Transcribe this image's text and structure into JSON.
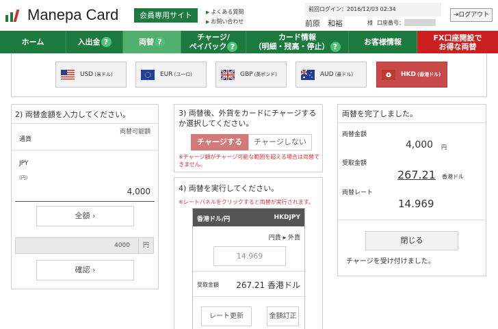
{
  "header": {
    "logo_text": "Manepa Card",
    "member_badge": "会員専用サイト",
    "faq_link": "よくある質問",
    "contact_link": "お問い合わせ",
    "last_login": "前回ログイン：2016/12/03 02:34",
    "user_name": "前原　和裕",
    "honorific": "様",
    "account_label": "口座番号：",
    "logout_label": "ログアウト",
    "logo_colors": [
      "#1d7a3f",
      "#1d7a3f",
      "#c0392b"
    ]
  },
  "nav": {
    "items": [
      {
        "label": "ホーム",
        "help": false
      },
      {
        "label": "入出金",
        "help": true
      },
      {
        "label": "両替",
        "help": true
      },
      {
        "label_line1": "チャージ/",
        "label_line2": "ペイバック",
        "help": true
      },
      {
        "label_line1": "カード情報",
        "label_line2": "（明細・残高・停止）",
        "help": true
      },
      {
        "label": "お客様情報",
        "help": false
      },
      {
        "label_line1": "FX口座開設で",
        "label_line2": "お得な両替",
        "help": false
      }
    ],
    "help_glyph": "?",
    "active_index": 2,
    "color_primary": "#1d7a3f",
    "color_active": "#52b06e",
    "color_fx": "#cc1f1f"
  },
  "currencies": [
    {
      "code": "USD",
      "name": "(米ドル)",
      "flag": "us-flag-icon"
    },
    {
      "code": "EUR",
      "name": "(ユーロ)",
      "flag": "eu-flag-icon"
    },
    {
      "code": "GBP",
      "name": "(英ポンド)",
      "flag": "uk-flag-icon"
    },
    {
      "code": "AUD",
      "name": "(豪ドル)",
      "flag": "au-flag-icon"
    },
    {
      "code": "HKD",
      "name": "(香港ドル)",
      "flag": "hk-flag-icon",
      "selected": true
    }
  ],
  "step2": {
    "title": "2) 両替金額を入力してください。",
    "available_label": "両替可能額",
    "currency_label": "通貨",
    "currency": "JPY",
    "currency_unit": "(円)",
    "amount": "4,000",
    "all_button": "全額 ›",
    "input_value": "4000",
    "input_unit": "円",
    "confirm_button": "確認 ›"
  },
  "step3": {
    "title": "3) 両替後、外貨をカードにチャージするか選択してください。",
    "charge_label": "チャージする",
    "no_charge_label": "チャージしない",
    "note": "※チャージ額がチャージ可能な範囲を超える場合は両替できません。"
  },
  "step4": {
    "title": "4) 両替を実行してください。",
    "note": "※レートパネルをクリックすると両替が実行されます。",
    "pair_name": "香港ドル/円",
    "pair_code": "HKDJPY",
    "direction": "円貨 ▸ 外貨",
    "rate": "14.969",
    "received_label": "受取金額",
    "received_value": "267.21 香港ドル",
    "update_rate_button": "レート更新",
    "correct_amount_button": "金額訂正"
  },
  "complete": {
    "title": "両替を完了しました。",
    "exchange_amount_label": "両替金額",
    "exchange_amount": "4,000",
    "exchange_unit": "円",
    "received_label": "受取金額",
    "received_value": "267.21",
    "received_unit": "香港ドル",
    "rate_label": "両替レート",
    "rate_value": "14.969",
    "close_button": "閉じる",
    "charge_accepted": "チャージを受け付けました。"
  }
}
